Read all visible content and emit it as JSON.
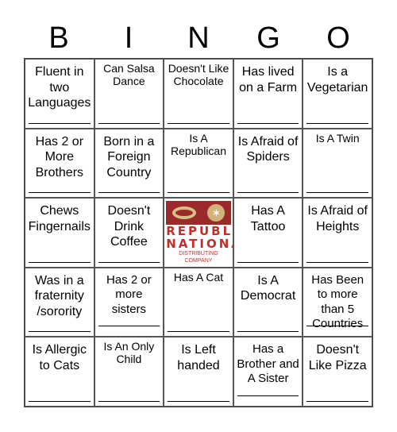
{
  "header": {
    "letters": [
      "B",
      "I",
      "N",
      "G",
      "O"
    ]
  },
  "cells": [
    {
      "text": "Fluent in two Languages",
      "size": "lg"
    },
    {
      "text": "Can Salsa Dance",
      "size": "sm"
    },
    {
      "text": "Doesn't Like Chocolate",
      "size": "sm"
    },
    {
      "text": "Has lived on a Farm",
      "size": "lg"
    },
    {
      "text": "Is a Vegetarian",
      "size": "lg"
    },
    {
      "text": "Has 2 or More Brothers",
      "size": "lg"
    },
    {
      "text": "Born in a Foreign Country",
      "size": "lg"
    },
    {
      "text": "Is A Republican",
      "size": "sm"
    },
    {
      "text": "Is Afraid of Spiders",
      "size": "lg"
    },
    {
      "text": "Is A Twin",
      "size": "sm"
    },
    {
      "text": "Chews Fingernails",
      "size": "lg"
    },
    {
      "text": "Doesn't Drink Coffee",
      "size": "lg"
    },
    {
      "free": true,
      "logo": {
        "line1": "REPUBLIC",
        "line2": "NATIONAL",
        "line3": "DISTRIBUTING COMPANY"
      }
    },
    {
      "text": "Has A Tattoo",
      "size": "lg"
    },
    {
      "text": "Is Afraid of Heights",
      "size": "lg"
    },
    {
      "text": "Was in a fraternity /sorority",
      "size": "lg"
    },
    {
      "text": "Has 2 or more sisters",
      "size": "md"
    },
    {
      "text": "Has A Cat",
      "size": "sm"
    },
    {
      "text": "Is A Democrat",
      "size": "lg"
    },
    {
      "text": "Has Been to more than 5 Countries",
      "size": "md"
    },
    {
      "text": "Is Allergic to Cats",
      "size": "lg"
    },
    {
      "text": "Is An Only Child",
      "size": "sm"
    },
    {
      "text": "Is Left handed",
      "size": "lg"
    },
    {
      "text": "Has a Brother and A Sister",
      "size": "md"
    },
    {
      "text": "Doesn't Like Pizza",
      "size": "lg"
    }
  ]
}
